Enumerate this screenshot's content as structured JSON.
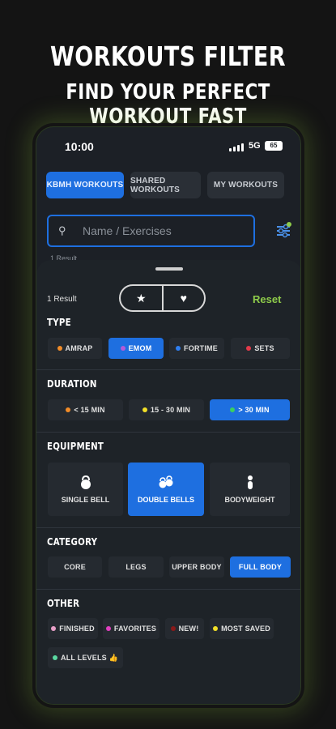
{
  "promo": {
    "title": "WORKOUTS FILTER",
    "subtitle": "FIND YOUR PERFECT WORKOUT FAST"
  },
  "status_bar": {
    "time": "10:00",
    "network": "5G",
    "battery": "65"
  },
  "tabs": [
    {
      "label": "KBMH WORKOUTS",
      "active": true
    },
    {
      "label": "SHARED WORKOUTS",
      "active": false
    },
    {
      "label": "MY WORKOUTS",
      "active": false
    }
  ],
  "search": {
    "placeholder": "Name / Exercises",
    "value": ""
  },
  "result_peek": "1 Result",
  "sheet": {
    "results": "1 Result",
    "reset": "Reset",
    "favorites_toggle": {
      "left_icon": "star-icon",
      "right_icon": "heart-icon"
    }
  },
  "type": {
    "title": "TYPE",
    "options": [
      {
        "label": "AMRAP",
        "color": "#f28c28",
        "active": false
      },
      {
        "label": "EMOM",
        "color": "#b45ad8",
        "active": true
      },
      {
        "label": "FORTIME",
        "color": "#2f7ff0",
        "active": false
      },
      {
        "label": "SETS",
        "color": "#e23a4a",
        "active": false
      }
    ]
  },
  "duration": {
    "title": "DURATION",
    "options": [
      {
        "label": "< 15 MIN",
        "color": "#f28c28",
        "active": false
      },
      {
        "label": "15 - 30 MIN",
        "color": "#f2e028",
        "active": false
      },
      {
        "label": "> 30 MIN",
        "color": "#3ad060",
        "active": true
      }
    ]
  },
  "equipment": {
    "title": "EQUIPMENT",
    "options": [
      {
        "label": "SINGLE BELL",
        "icon": "kettlebell-icon",
        "active": false
      },
      {
        "label": "DOUBLE BELLS",
        "icon": "double-kettlebell-icon",
        "active": true
      },
      {
        "label": "BODYWEIGHT",
        "icon": "person-icon",
        "active": false
      }
    ]
  },
  "category": {
    "title": "CATEGORY",
    "options": [
      {
        "label": "CORE",
        "active": false
      },
      {
        "label": "LEGS",
        "active": false
      },
      {
        "label": "UPPER BODY",
        "active": false
      },
      {
        "label": "FULL BODY",
        "active": true
      }
    ]
  },
  "other": {
    "title": "OTHER",
    "options": [
      {
        "label": "FINISHED",
        "color": "#e8a0c8",
        "active": false
      },
      {
        "label": "FAVORITES",
        "color": "#e040c0",
        "active": false
      },
      {
        "label": "NEW!",
        "color": "#8a1a1a",
        "active": false
      },
      {
        "label": "MOST SAVED",
        "color": "#f2e028",
        "active": false
      },
      {
        "label": "ALL LEVELS 👍",
        "color": "#5ad8a0",
        "active": false
      }
    ]
  }
}
